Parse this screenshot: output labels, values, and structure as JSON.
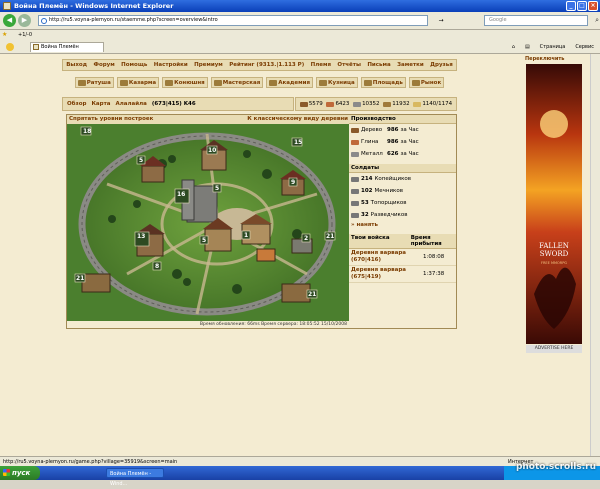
{
  "window": {
    "title": "Война Племён - Windows Internet Explorer",
    "min": "_",
    "max": "□",
    "close": "×"
  },
  "browser": {
    "url": "http://ru5.voyna-plemyon.ru/staemme.php?screen=overview&intro",
    "search_placeholder": "Google",
    "go_label": "→",
    "fav_counter": "+1/-0",
    "tab_title": "Война Племён",
    "tools": [
      "Страница",
      "Сервис"
    ],
    "status_url": "http://ru5.voyna-plemyon.ru/game.php?village=35919&screen=main",
    "status_zone": "Интернет"
  },
  "menu": [
    "Выход",
    "Форум",
    "Помощь",
    "Настройки",
    "Премиум",
    "Рейтинг (9313.|1.113 P)",
    "Племя",
    "Отчёты",
    "Письма",
    "Заметки",
    "Друзья"
  ],
  "buildings": [
    "Ратуша",
    "Казарма",
    "Конюшня",
    "Мастерская",
    "Академия",
    "Кузница",
    "Площадь",
    "Рынок"
  ],
  "village": {
    "overview": "Обзор",
    "map": "Карта",
    "name": "Алалайла",
    "coords": "(673|415) K46"
  },
  "resources": {
    "wood": "5579",
    "clay": "6423",
    "iron": "10352",
    "storage": "11932",
    "farm": "1140/1174",
    "colors": {
      "wood": "#8a5a2a",
      "clay": "#c06a3a",
      "iron": "#8a8a8a",
      "storage": "#a07a3a",
      "farm": "#d8b860"
    }
  },
  "map": {
    "hide_levels": "Спрятать уровни построек",
    "classic_view": "К классическому виду деревни",
    "footer": "Время обновления: 66ms Время сервера: 18:05:52 15/10/2008",
    "levels": [
      "18",
      "15",
      "5",
      "10",
      "16",
      "5",
      "5",
      "9",
      "13",
      "1",
      "2",
      "8",
      "21",
      "21",
      "21"
    ]
  },
  "production": {
    "title": "Производство",
    "rows": [
      {
        "name": "Дерево",
        "value": "986",
        "unit": "за Час"
      },
      {
        "name": "Глина",
        "value": "986",
        "unit": "за Час"
      },
      {
        "name": "Металл",
        "value": "626",
        "unit": "за Час"
      }
    ]
  },
  "soldiers": {
    "title": "Солдаты",
    "rows": [
      {
        "count": "214",
        "name": "Копейщиков"
      },
      {
        "count": "102",
        "name": "Мечников"
      },
      {
        "count": "53",
        "name": "Топорщиков"
      },
      {
        "count": "32",
        "name": "Разведчиков"
      }
    ],
    "hire": "» нанять"
  },
  "troops": {
    "header_a": "Твои войска",
    "header_b": "Время прибытия",
    "rows": [
      {
        "target": "Деревня варвара (670|416)",
        "time": "1:08:08"
      },
      {
        "target": "Деревня варвара (675|419)",
        "time": "1:37:38"
      }
    ]
  },
  "ad": {
    "label": "Переключить",
    "title_a": "FALLEN",
    "title_b": "SWORD",
    "sub": "FREE MMORPG",
    "advertise": "ADVERTISE HERE"
  },
  "taskbar": {
    "start": "пуск",
    "task": "Война Племён - Wind..."
  },
  "watermark": "photo.scrolls.ru"
}
